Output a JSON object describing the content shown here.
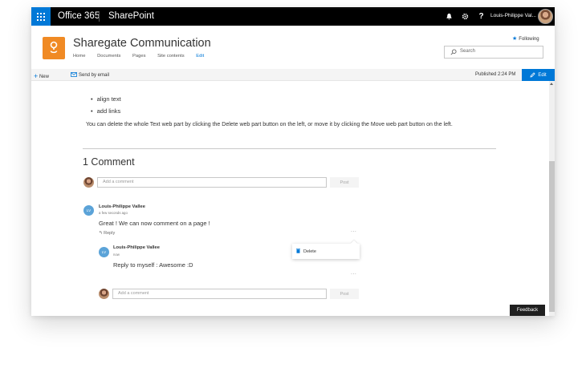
{
  "suite": {
    "app_launcher": "app-launcher",
    "office": "Office 365",
    "product": "SharePoint",
    "user_name": "Louis-Philippe Val..."
  },
  "site": {
    "title": "Sharegate Communication",
    "nav": [
      "Home",
      "Documents",
      "Pages",
      "Site contents",
      "Edit"
    ],
    "following_label": "Following",
    "search_placeholder": "Search"
  },
  "commandbar": {
    "new_label": "New",
    "email_label": "Send by email",
    "published": "Published 2:24 PM",
    "edit_label": "Edit"
  },
  "content": {
    "bullets": [
      "align text",
      "add links"
    ],
    "paragraph": "You can delete the whole Text web part by clicking the Delete web part button on the left, or move it by clicking the Move web part button on the left."
  },
  "comments": {
    "heading": "1 Comment",
    "add_placeholder": "Add a comment",
    "post_label": "Post",
    "items": [
      {
        "initials": "LV",
        "author": "Louis-Philippe Vallee",
        "time": "a few seconds ago",
        "text": "Great ! We can now comment on a page !",
        "reply_label": "Reply",
        "replies": [
          {
            "initials": "LV",
            "author": "Louis-Philippe Vallee",
            "time": "now",
            "text": "Reply to myself : Awesome :D"
          }
        ]
      }
    ],
    "menu": {
      "delete_label": "Delete"
    },
    "more_label": "..."
  },
  "feedback_label": "Feedback",
  "colors": {
    "accent": "#0078d7",
    "suite_bar": "#000000",
    "site_logo": "#f08a24",
    "avatar": "#5ba3d8"
  }
}
